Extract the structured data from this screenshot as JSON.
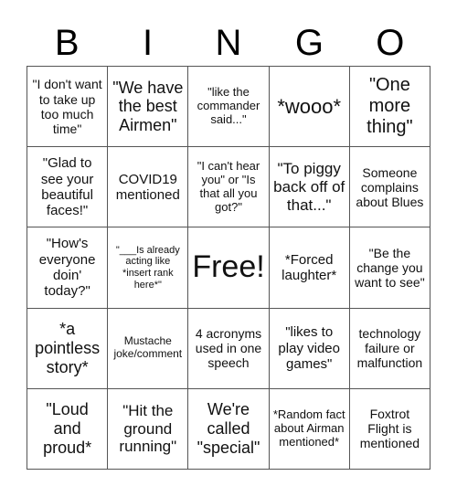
{
  "header": {
    "letters": [
      "B",
      "I",
      "N",
      "G",
      "O"
    ]
  },
  "cells": [
    "\"I don't want to take up too much time\"",
    "\"We have the best Airmen\"",
    "\"like the commander said...\"",
    "*wooo*",
    "\"One more thing\"",
    "\"Glad to see your beautiful faces!\"",
    "COVID19 mentioned",
    "\"I can't hear you\" or \"Is that all you got?\"",
    "\"To piggy back off of that...\"",
    "Someone complains about Blues",
    "\"How's everyone doin' today?\"",
    "\"___Is already acting like *insert rank here*\"",
    "Free!",
    "*Forced laughter*",
    "\"Be the change you want to see\"",
    "*a pointless story*",
    "Mustache joke/comment",
    "4 acronyms used in one speech",
    "\"likes to play video games\"",
    "technology failure or malfunction",
    "\"Loud and proud*",
    "\"Hit the ground running\"",
    "We're called \"special\"",
    "*Random fact about Airman mentioned*",
    "Foxtrot Flight is mentioned"
  ]
}
